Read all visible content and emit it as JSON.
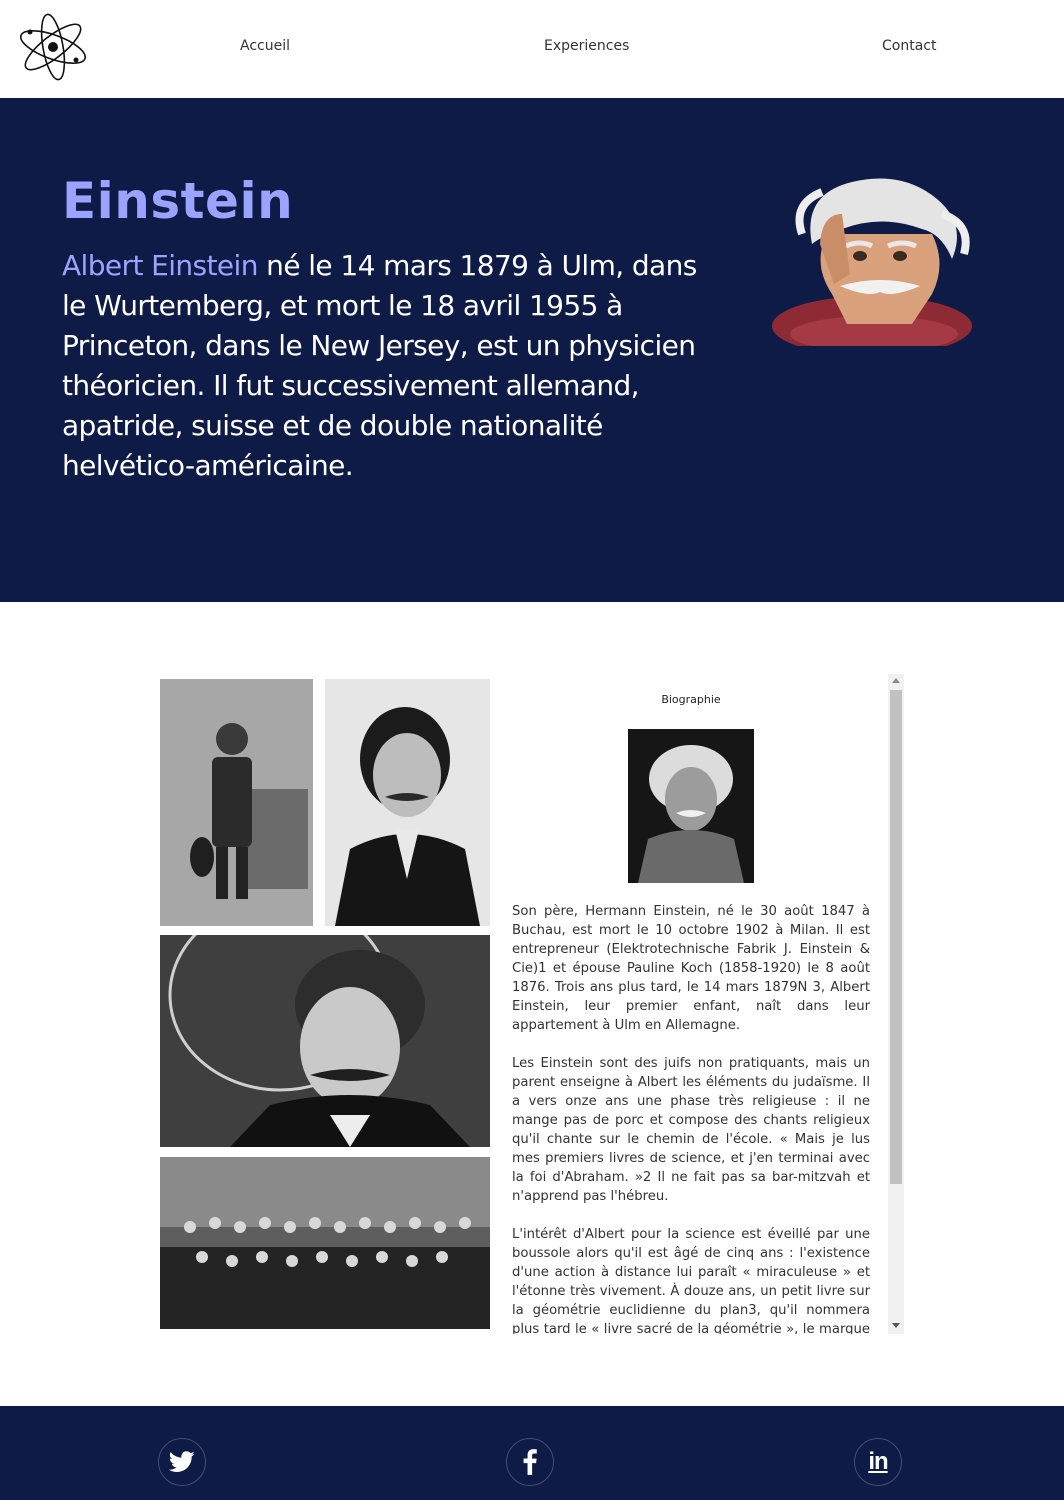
{
  "nav": {
    "items": [
      {
        "label": "Accueil"
      },
      {
        "label": "Experiences"
      },
      {
        "label": "Contact"
      }
    ]
  },
  "hero": {
    "title": "Einstein",
    "name": "Albert Einstein",
    "text": " né le 14 mars 1879 à Ulm, dans le Wurtemberg, et mort le 18 avril 1955 à Princeton, dans le New Jersey, est un physicien théoricien. Il fut successivement allemand, apatride, suisse et de double nationalité helvético-américaine."
  },
  "bio": {
    "title": "Biographie",
    "paragraphs": [
      "Son père, Hermann Einstein, né le 30 août 1847 à Buchau, est mort le 10 octobre 1902 à Milan. Il est entrepreneur (Elektrotechnische Fabrik J. Einstein & Cie)1 et épouse Pauline Koch (1858-1920) le 8 août 1876. Trois ans plus tard, le 14 mars 1879N 3, Albert Einstein, leur premier enfant, naît dans leur appartement à Ulm en Allemagne.",
      "Les Einstein sont des juifs non pratiquants, mais un parent enseigne à Albert les éléments du judaïsme. Il a vers onze ans une phase très religieuse : il ne mange pas de porc et compose des chants religieux qu'il chante sur le chemin de l'école. « Mais je lus mes premiers livres de science, et j'en terminai avec la foi d'Abraham. »2 Il ne fait pas sa bar-mitzvah et n'apprend pas l'hébreu.",
      "L'intérêt d'Albert pour la science est éveillé par une boussole alors qu'il est âgé de cinq ans : l'existence d'une action à distance lui paraît « miraculeuse » et l'étonne très vivement. À douze ans, un petit livre sur la géométrie euclidienne du plan3, qu'il nommera plus tard le « livre sacré de la géométrie », le marque profondément."
    ]
  },
  "footer": {
    "social": [
      "twitter-icon",
      "facebook-icon",
      "linkedin-icon"
    ],
    "linkedin_text": "in"
  }
}
